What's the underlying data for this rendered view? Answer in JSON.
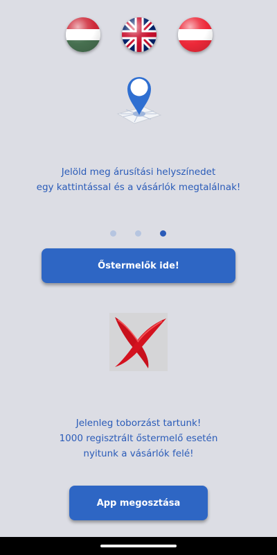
{
  "languages": [
    {
      "code": "hu",
      "name": "hungary-flag"
    },
    {
      "code": "en",
      "name": "uk-flag"
    },
    {
      "code": "de",
      "name": "austria-flag"
    }
  ],
  "icons": {
    "location": "map-pin-icon",
    "unavailable": "red-x-icon"
  },
  "info_text": {
    "line1": "Jelöld meg árusítási helyszínedet",
    "line2": "egy kattintással és a vásárlók megtalálnak!"
  },
  "pager": {
    "total": 3,
    "active_index": 2
  },
  "buttons": {
    "producers_label": "Őstermelők ide!",
    "share_label": "App megosztása"
  },
  "recruit_text": {
    "line1": "Jelenleg toborzást tartunk!",
    "line2": "1000 regisztrált őstermelő esetén",
    "line3": "nyitunk a vásárlók felé!"
  },
  "colors": {
    "background": "#dcdde4",
    "primary": "#2e66c4",
    "text": "#2a5bb8",
    "error": "#c8102e"
  }
}
